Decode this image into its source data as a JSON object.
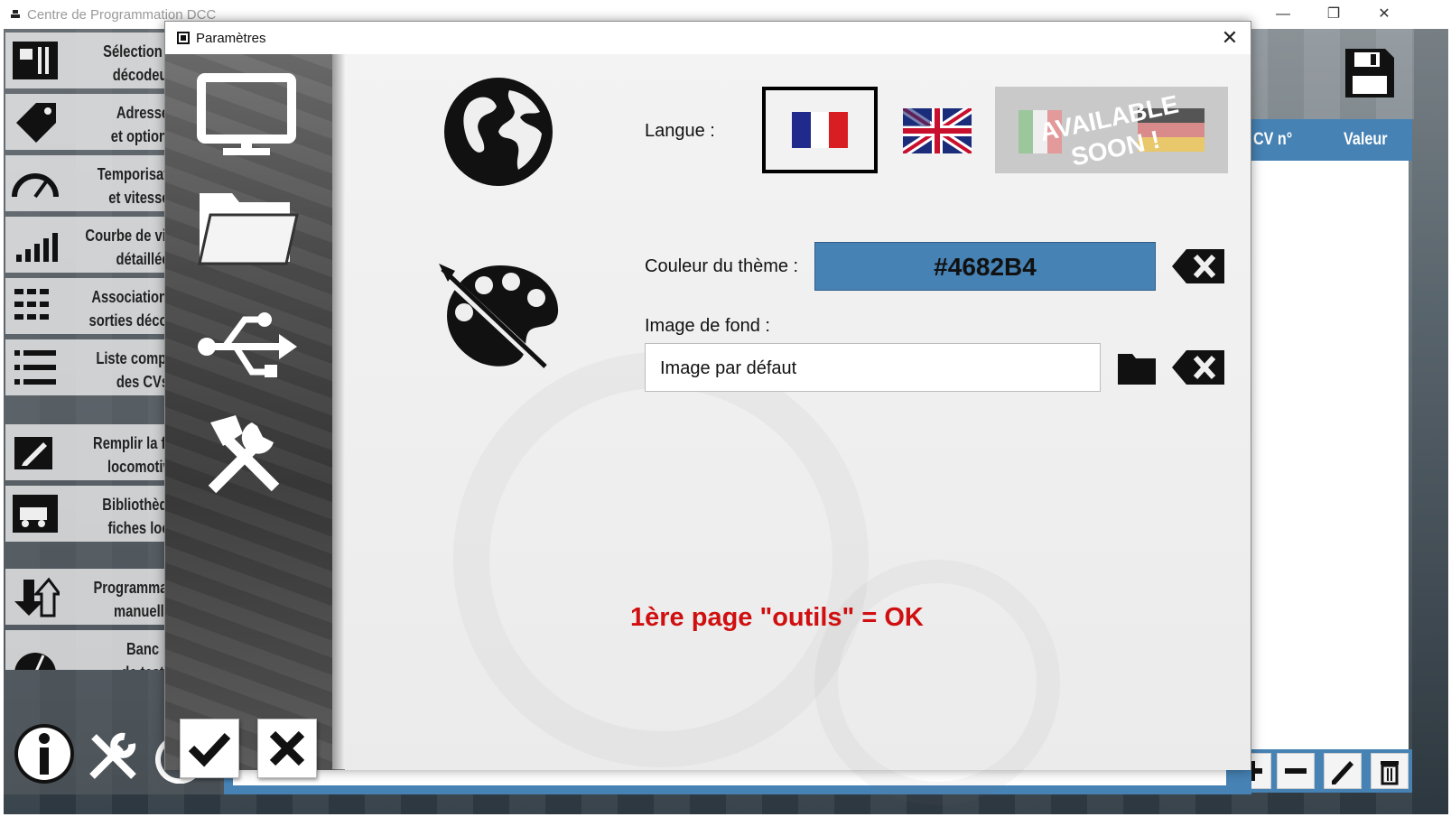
{
  "main_window": {
    "title": "Centre de Programmation DCC",
    "controls": {
      "minimize": "—",
      "maximize": "❐",
      "close": "✕"
    }
  },
  "side_menu": {
    "items": [
      {
        "label": "Sélection du\ndécodeur",
        "icon": "decoder-chip-icon"
      },
      {
        "label": "Adresse\net options",
        "icon": "tag-icon"
      },
      {
        "label": "Temporisation\net vitesses",
        "icon": "speedometer-icon"
      },
      {
        "label": "Courbe de vitesse\ndétaillée",
        "icon": "bar-chart-icon"
      },
      {
        "label": "Association des\nsorties décodeur",
        "icon": "grid-icon"
      },
      {
        "label": "Liste complète\ndes CVs",
        "icon": "list-icon"
      },
      {
        "label": "Remplir la fiche\nlocomotive",
        "icon": "edit-icon"
      },
      {
        "label": "Bibliothèque\nfiches loco",
        "icon": "locomotive-icon"
      },
      {
        "label": "Programmation\nmanuelle",
        "icon": "transfer-icon"
      },
      {
        "label": "Banc\nde test",
        "icon": "gauge-icon"
      }
    ],
    "bottom_icons": [
      "info-icon",
      "tools-icon",
      "power-icon"
    ]
  },
  "cv_panel": {
    "col_cv": "CV n°",
    "col_value": "Valeur",
    "tools": [
      "add-icon",
      "remove-icon",
      "pencil-icon",
      "trash-icon"
    ]
  },
  "dialog": {
    "title": "Paramètres",
    "close": "✕",
    "nav": [
      "monitor-icon",
      "folder-icon",
      "usb-icon",
      "tools-icon"
    ],
    "actions": {
      "ok": "check-icon",
      "cancel": "cross-icon"
    },
    "language": {
      "label": "Langue :",
      "selected": "fr",
      "options": [
        "fr",
        "en"
      ],
      "coming_soon": "AVAILABLE\nSOON !"
    },
    "theme": {
      "label": "Couleur du thème :",
      "value": "#4682B4",
      "color": "#4682b4"
    },
    "background": {
      "label": "Image de fond :",
      "value": "Image par défaut"
    },
    "note": "1ère page \"outils\" = OK"
  }
}
